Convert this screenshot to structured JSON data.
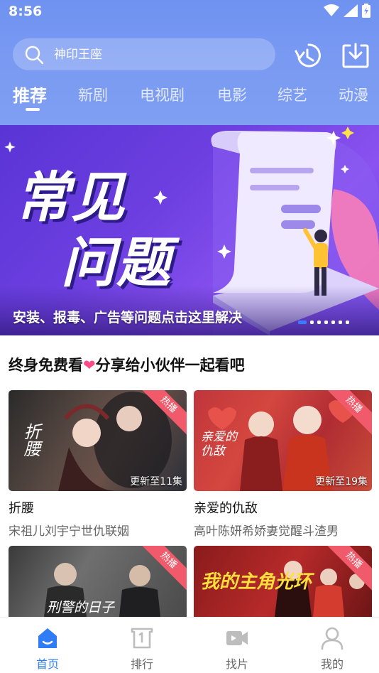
{
  "status_bar": {
    "time": "8:56"
  },
  "search": {
    "placeholder": "神印王座"
  },
  "tabs": [
    {
      "label": "推荐",
      "active": true
    },
    {
      "label": "新剧"
    },
    {
      "label": "电视剧"
    },
    {
      "label": "电影"
    },
    {
      "label": "综艺"
    },
    {
      "label": "动漫"
    }
  ],
  "banner": {
    "title_line1": "常见",
    "title_line2": "问题",
    "caption": "安装、报毒、广告等问题点击这里解决",
    "dot_count": 7,
    "active_dot": 0
  },
  "share_section": {
    "title_before": "终身免费看",
    "title_after": "分享给小伙伴一起看吧",
    "heart_icon": "heart-icon"
  },
  "cards": [
    {
      "title": "折腰",
      "desc": "宋祖儿刘宇宁世仇联姻",
      "badge": "热播",
      "episodes": "更新至11集",
      "poster_text": "折腰"
    },
    {
      "title": "亲爱的仇敌",
      "desc": "高叶陈妍希娇妻觉醒斗渣男",
      "badge": "热播",
      "episodes": "更新至19集",
      "poster_text": "亲爱的仇敌"
    },
    {
      "title": "",
      "desc": "",
      "badge": "热播",
      "episodes": "",
      "poster_text": "刑警的日子"
    },
    {
      "title": "",
      "desc": "",
      "badge": "热播",
      "episodes": "",
      "poster_text": "我的主角光环"
    }
  ],
  "bottom_nav": [
    {
      "label": "首页",
      "icon": "home-icon",
      "active": true
    },
    {
      "label": "排行",
      "icon": "ranking-icon"
    },
    {
      "label": "找片",
      "icon": "video-camera-icon"
    },
    {
      "label": "我的",
      "icon": "user-icon"
    }
  ],
  "colors": {
    "accent": "#2f7cf6",
    "header": "#7a9af2",
    "hot": "#f05a6a",
    "heart": "#ff4a86"
  }
}
